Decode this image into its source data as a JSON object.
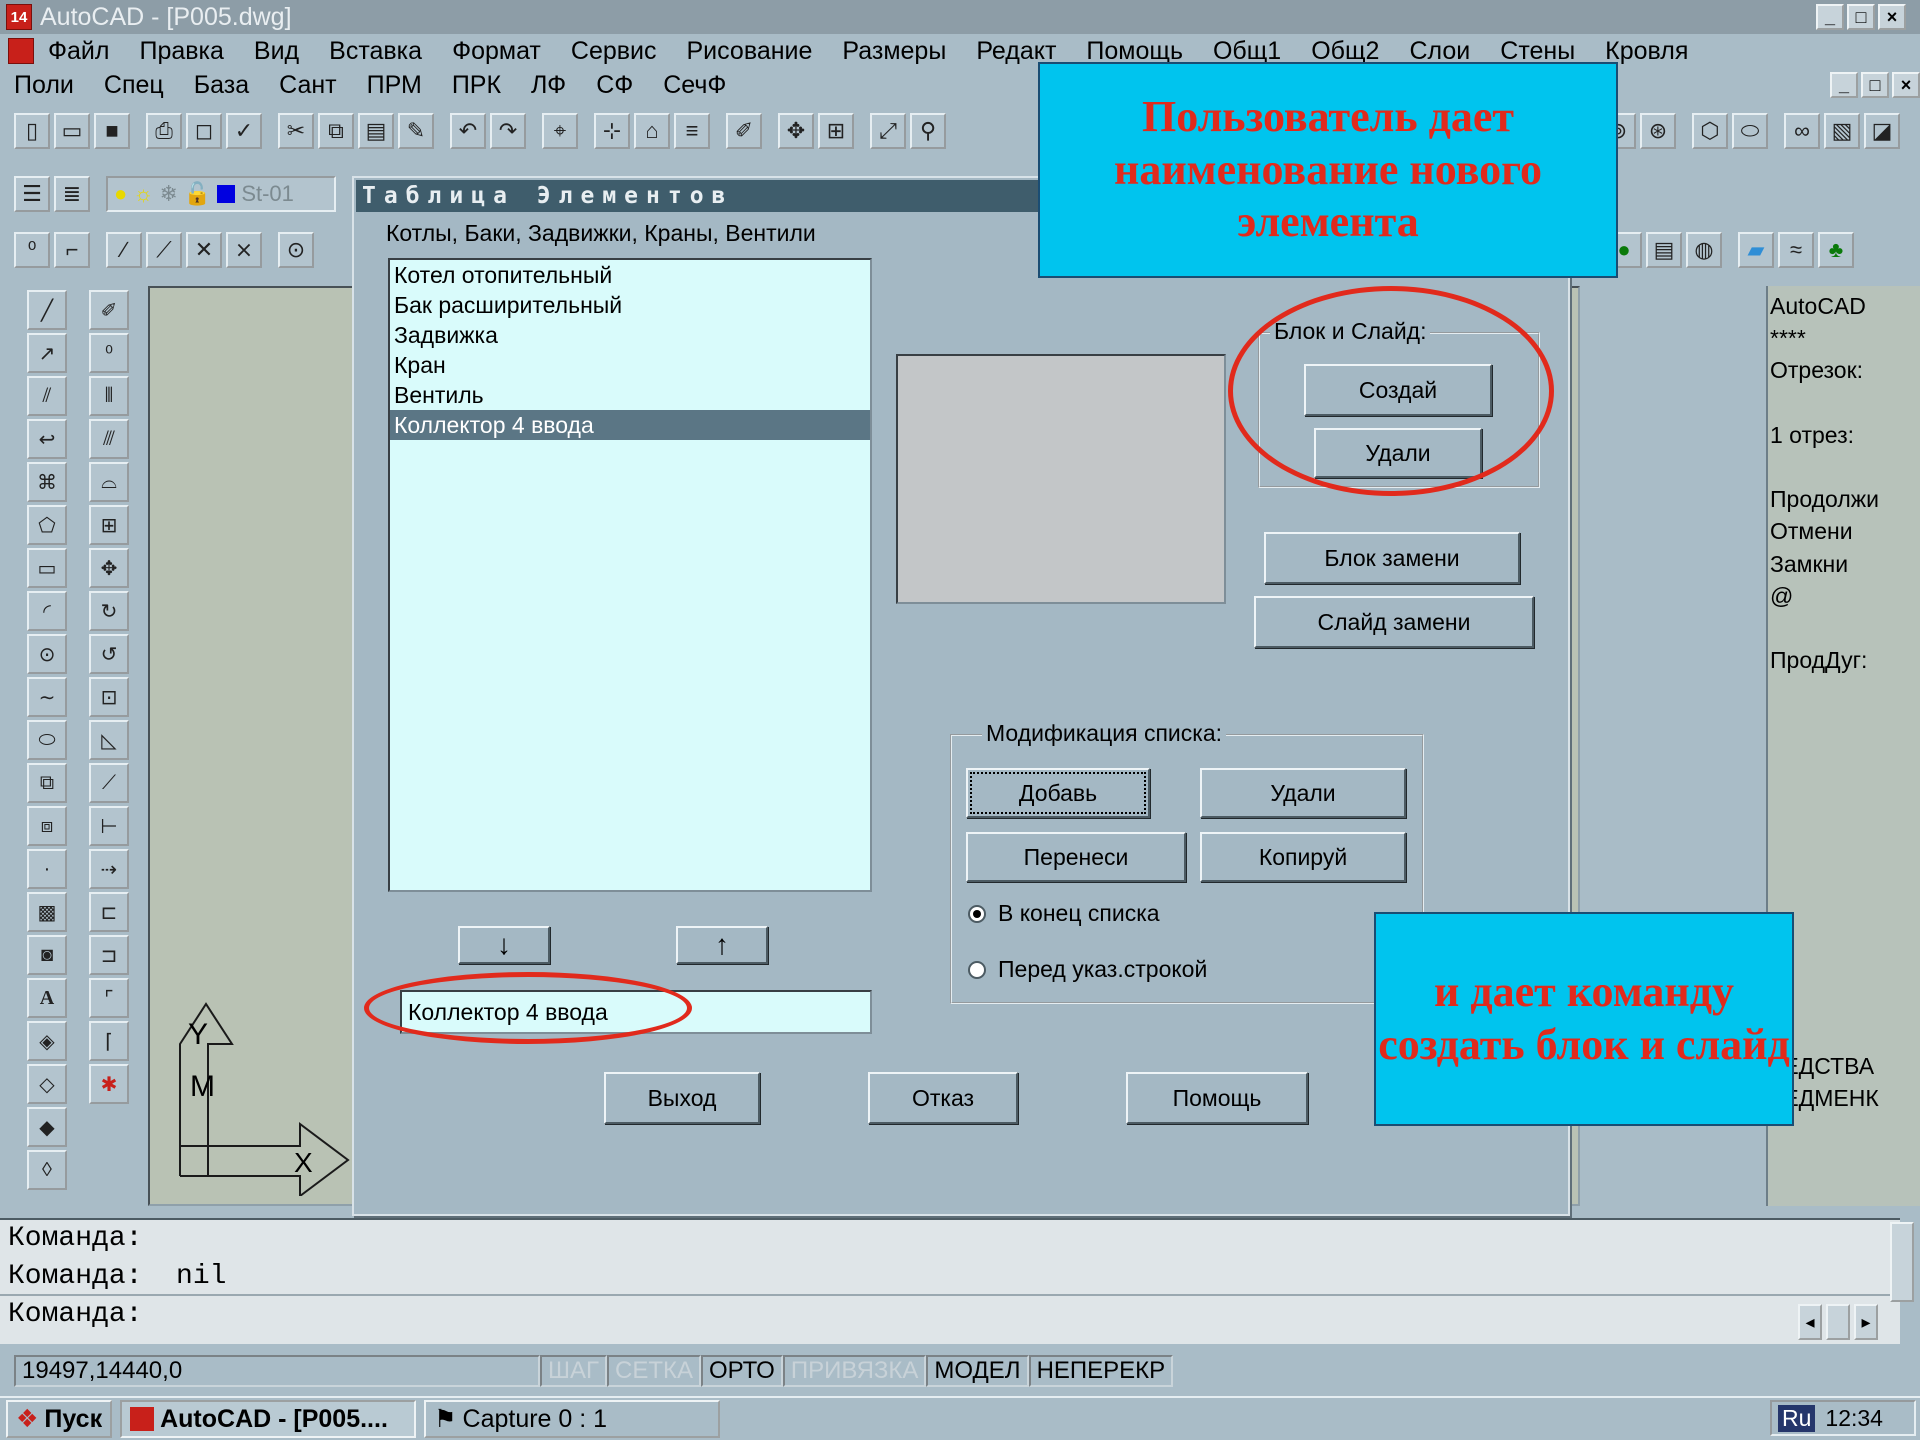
{
  "window": {
    "title": "AutoCAD - [P005.dwg]",
    "buttons": [
      "_",
      "□",
      "×"
    ]
  },
  "menu": {
    "row1": [
      "Файл",
      "Правка",
      "Вид",
      "Вставка",
      "Формат",
      "Сервис",
      "Рисование",
      "Размеры",
      "Редакт",
      "Помощь",
      "Общ1",
      "Общ2",
      "Слои",
      "Стены",
      "Кровля"
    ],
    "row2": [
      "Поли",
      "Спец",
      "База",
      "Сант",
      "ПРМ",
      "ПРК",
      "ЛФ",
      "СФ",
      "СечФ"
    ]
  },
  "layer": {
    "name": "St-01"
  },
  "dialog": {
    "title": "Таблица Элементов",
    "category": "Котлы, Баки, Задвижки, Краны, Вентили",
    "items": [
      "Котел отопительный",
      "Бак расширительный",
      "Задвижка",
      "Кран",
      "Вентиль",
      "Коллектор 4 ввода"
    ],
    "selected_index": 5,
    "arrow_down": "↓",
    "arrow_up": "↑",
    "name_value": "Коллектор 4 ввода",
    "block_group": {
      "label": "Блок и Слайд:",
      "create": "Создай",
      "delete": "Удали"
    },
    "replace_block": "Блок замени",
    "replace_slide": "Слайд замени",
    "modify_group": {
      "label": "Модификация списка:",
      "add": "Добавь",
      "delete": "Удали",
      "move": "Перенеси",
      "copy": "Копируй",
      "radio_end": "В конец списка",
      "radio_before": "Перед указ.строкой",
      "selected_radio": "end"
    },
    "exit": "Выход",
    "cancel": "Отказ",
    "help": "Помощь"
  },
  "annotations": {
    "top": "Пользователь дает наименование нового элемента",
    "bottom": "и дает команду создать блок и слайд",
    "color_text": "#e12a1c",
    "color_bg": "#00c4ee"
  },
  "side_menu": [
    "AutoCAD",
    "****",
    "Отрезок:",
    "",
    "1 отрез:",
    "",
    "Продолжи",
    "Отмени",
    "Замкни",
    "@",
    "",
    "ПродДуг:"
  ],
  "side_menu_bottom": [
    "РЕДСТВА",
    "РЕДМЕНК"
  ],
  "ucs": {
    "y": "Y",
    "m": "M",
    "x": "X"
  },
  "command_lines": [
    "Команда:",
    "Команда:  nil",
    "Команда:"
  ],
  "status": {
    "coords": "19497,14440,0",
    "modes": [
      {
        "label": "ШАГ",
        "on": false
      },
      {
        "label": "СЕТКА",
        "on": false
      },
      {
        "label": "ОРТО",
        "on": true
      },
      {
        "label": "ПРИВЯЗКА",
        "on": false
      },
      {
        "label": "МОДЕЛ",
        "on": true
      },
      {
        "label": "НЕПЕРЕКР",
        "on": true
      }
    ]
  },
  "taskbar": {
    "start": "Пуск",
    "tasks": [
      "AutoCAD - [P005....",
      "Capture 0 : 1"
    ],
    "lang": "Ru",
    "time": "12:34"
  }
}
